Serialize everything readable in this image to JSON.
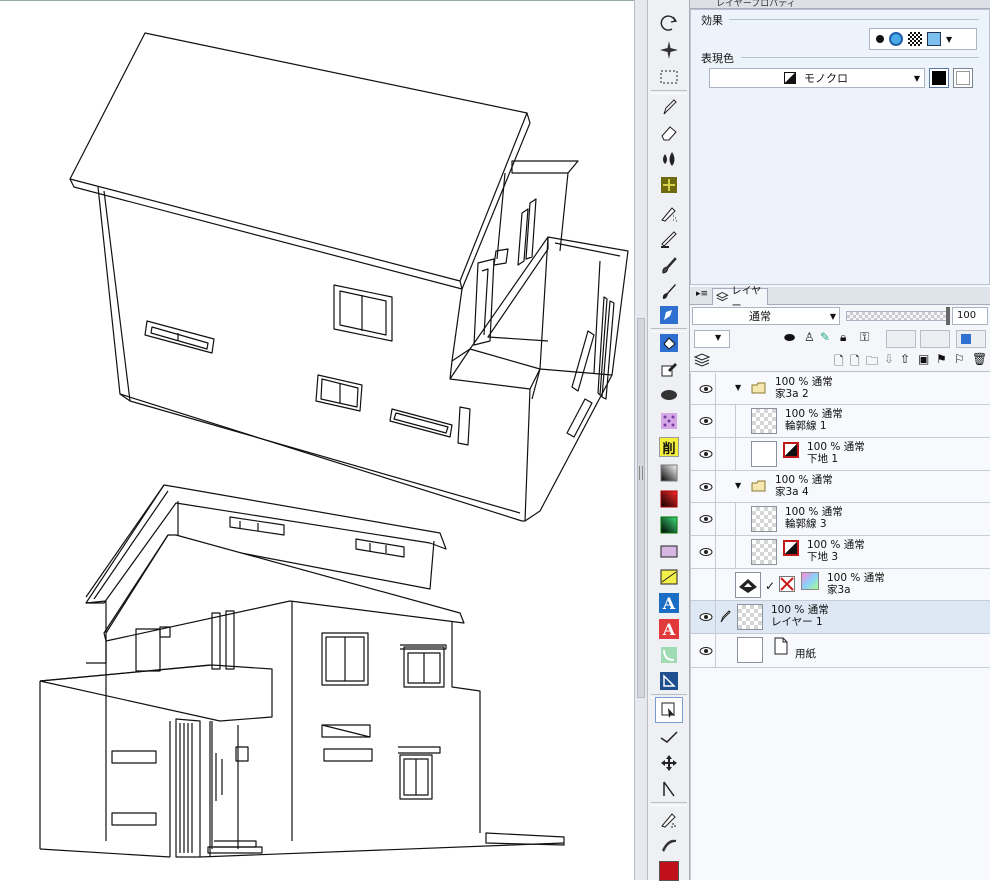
{
  "panel_tabs": {
    "property_title": "レイヤープロパティ",
    "layer_title": "レイヤー"
  },
  "property": {
    "effect_label": "効果",
    "expression_label": "表現色",
    "expression_value": "モノクロ"
  },
  "layer_panel": {
    "blend_mode": "通常",
    "opacity": "100"
  },
  "layers": [
    {
      "opacity": "100 %",
      "mode": "通常",
      "name": "家3a 2",
      "kind": "folder",
      "visible": true
    },
    {
      "opacity": "100 %",
      "mode": "通常",
      "name": "輪郭線 1",
      "kind": "raster",
      "visible": true
    },
    {
      "opacity": "100 %",
      "mode": "通常",
      "name": "下地 1",
      "kind": "mono",
      "visible": true
    },
    {
      "opacity": "100 %",
      "mode": "通常",
      "name": "家3a 4",
      "kind": "folder",
      "visible": true
    },
    {
      "opacity": "100 %",
      "mode": "通常",
      "name": "輪郭線 3",
      "kind": "raster",
      "visible": true
    },
    {
      "opacity": "100 %",
      "mode": "通常",
      "name": "下地 3",
      "kind": "mono",
      "visible": true
    },
    {
      "opacity": "100 %",
      "mode": "通常",
      "name": "家3a",
      "kind": "3d",
      "visible": false
    },
    {
      "opacity": "100 %",
      "mode": "通常",
      "name": "レイヤー 1",
      "kind": "raster",
      "visible": true,
      "selected": true
    },
    {
      "opacity": "",
      "mode": "",
      "name": "用紙",
      "kind": "paper",
      "visible": true
    }
  ],
  "tools": [
    "rotate-icon",
    "sparkle-icon",
    "selection-icon",
    "pen-icon",
    "eraser-icon",
    "drops-icon",
    "decoration-icon",
    "airbrush-icon",
    "blend-icon",
    "brush-icon",
    "fill-pen-icon",
    "pen-tool-icon",
    "bucket-icon",
    "eyedropper-icon",
    "lasso-fill-icon",
    "pattern-icon",
    "delete-icon",
    "gradient-icon",
    "gradient-red-icon",
    "gradient-green-icon",
    "frame-icon",
    "ruler-icon",
    "text-blue-icon",
    "text-red-icon",
    "balloon-icon",
    "triangle-ruler-icon",
    "object-icon",
    "line-correct-icon",
    "move-icon",
    "transform-icon",
    "smudge-icon",
    "stroke-icon",
    "color-icon"
  ],
  "labels": {
    "delete_tool": "削",
    "text_tool": "A"
  },
  "colors": {
    "main_color": "#c0101c",
    "accent": "#2e6fd0",
    "selection_bg": "#dde8f4"
  }
}
